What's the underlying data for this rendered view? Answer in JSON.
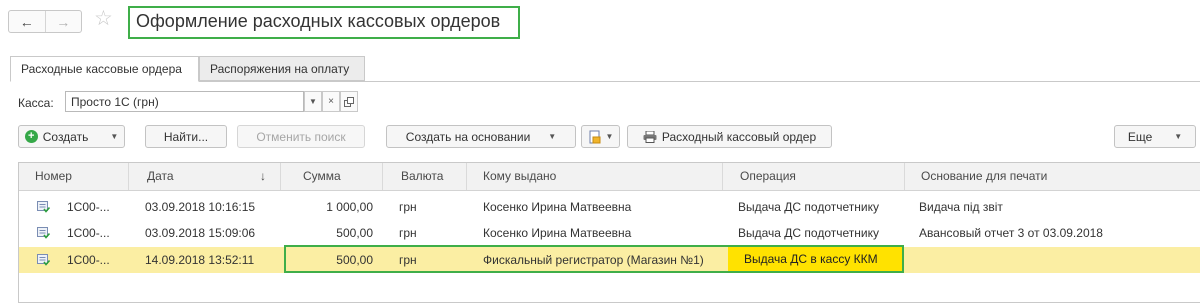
{
  "nav": {
    "back": "←",
    "forward": "→",
    "star": "☆"
  },
  "title": "Оформление расходных кассовых ордеров",
  "tabs": [
    "Расходные кассовые ордера",
    "Распоряжения на оплату"
  ],
  "kassa": {
    "label": "Касса:",
    "value": "Просто 1С (грн)"
  },
  "toolbar": {
    "create": "Создать",
    "find": "Найти...",
    "cancel_search": "Отменить поиск",
    "create_based": "Создать на основании",
    "print_order": "Расходный кассовый ордер",
    "more": "Еще"
  },
  "table": {
    "columns": [
      "Номер",
      "Дата",
      "Сумма",
      "Валюта",
      "Кому выдано",
      "Операция",
      "Основание для печати"
    ],
    "sort_indicator": "↓",
    "rows": [
      {
        "number": "1С00-...",
        "date": "03.09.2018 10:16:15",
        "sum": "1 000,00",
        "currency": "грн",
        "recipient": "Косенко Ирина Матвеевна",
        "operation": "Выдача ДС подотчетнику",
        "basis": "Видача під звіт"
      },
      {
        "number": "1С00-...",
        "date": "03.09.2018 15:09:06",
        "sum": "500,00",
        "currency": "грн",
        "recipient": "Косенко Ирина Матвеевна",
        "operation": "Выдача ДС подотчетнику",
        "basis": "Авансовый отчет 3 от 03.09.2018"
      },
      {
        "number": "1С00-...",
        "date": "14.09.2018 13:52:11",
        "sum": "500,00",
        "currency": "грн",
        "recipient": "Фискальный регистратор (Магазин №1)",
        "operation": "Выдача ДС в кассу ККМ",
        "basis": ""
      }
    ]
  },
  "colors": {
    "highlight_green": "#3fae49",
    "selected_row": "#fbeea3",
    "operation_highlight": "#ffe200"
  }
}
